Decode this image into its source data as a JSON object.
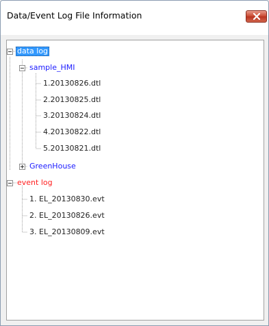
{
  "window": {
    "title": "Data/Event Log File Information"
  },
  "tree": {
    "data_log": {
      "label": "data log",
      "sample_hmi": {
        "label": "sample_HMI",
        "files": [
          "1.20130826.dtl",
          "2.20130825.dtl",
          "3.20130824.dtl",
          "4.20130822.dtl",
          "5.20130821.dtl"
        ]
      },
      "greenhouse": {
        "label": "GreenHouse"
      }
    },
    "event_log": {
      "label": "event log",
      "files": [
        "1. EL_20130830.evt",
        "2. EL_20130826.evt",
        "3. EL_20130809.evt"
      ]
    }
  },
  "colors": {
    "folder_text": "#1a1aff",
    "event_text": "#ff2020",
    "selection": "#3399ff"
  }
}
